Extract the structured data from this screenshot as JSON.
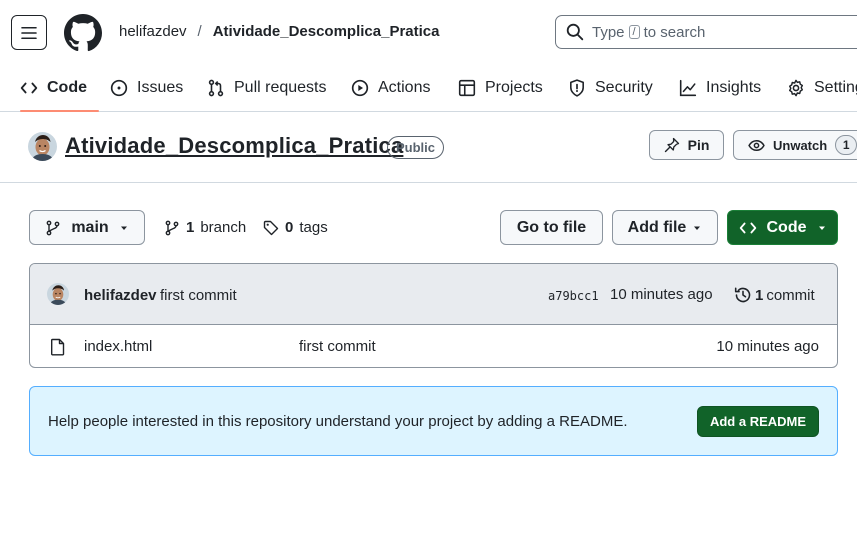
{
  "header": {
    "owner": "helifazdev",
    "separator": "/",
    "repo": "Atividade_Descomplica_Pratica",
    "search": {
      "prefix": "Type",
      "key": "/",
      "suffix": "to search"
    }
  },
  "tabs": [
    {
      "label": "Code",
      "icon": "code-icon",
      "active": true
    },
    {
      "label": "Issues",
      "icon": "issue-opened-icon"
    },
    {
      "label": "Pull requests",
      "icon": "git-pull-request-icon"
    },
    {
      "label": "Actions",
      "icon": "play-icon"
    },
    {
      "label": "Projects",
      "icon": "table-icon"
    },
    {
      "label": "Security",
      "icon": "shield-icon"
    },
    {
      "label": "Insights",
      "icon": "graph-icon"
    },
    {
      "label": "Settings",
      "icon": "gear-icon"
    }
  ],
  "repo_header": {
    "title": "Atividade_Descomplica_Pratica",
    "visibility": "Public",
    "pin_label": "Pin",
    "watch_label": "Unwatch",
    "watch_count": "1"
  },
  "branch_bar": {
    "branch": "main",
    "branch_count": "1",
    "branch_label": "branch",
    "tag_count": "0",
    "tag_label": "tags",
    "go_to_file": "Go to file",
    "add_file": "Add file",
    "code": "Code"
  },
  "latest_commit": {
    "author": "helifazdev",
    "message": "first commit",
    "sha": "a79bcc1",
    "time": "10 minutes ago",
    "count": "1",
    "count_label": "commit"
  },
  "files": [
    {
      "name": "index.html",
      "message": "first commit",
      "time": "10 minutes ago"
    }
  ],
  "readme_banner": {
    "text": "Help people interested in this repository understand your project by adding a README.",
    "button": "Add a README"
  },
  "colors": {
    "accent_green": "#116329",
    "tab_underline": "#fd8c73",
    "banner_bg": "#ddf4ff",
    "banner_border": "#54aeff"
  }
}
